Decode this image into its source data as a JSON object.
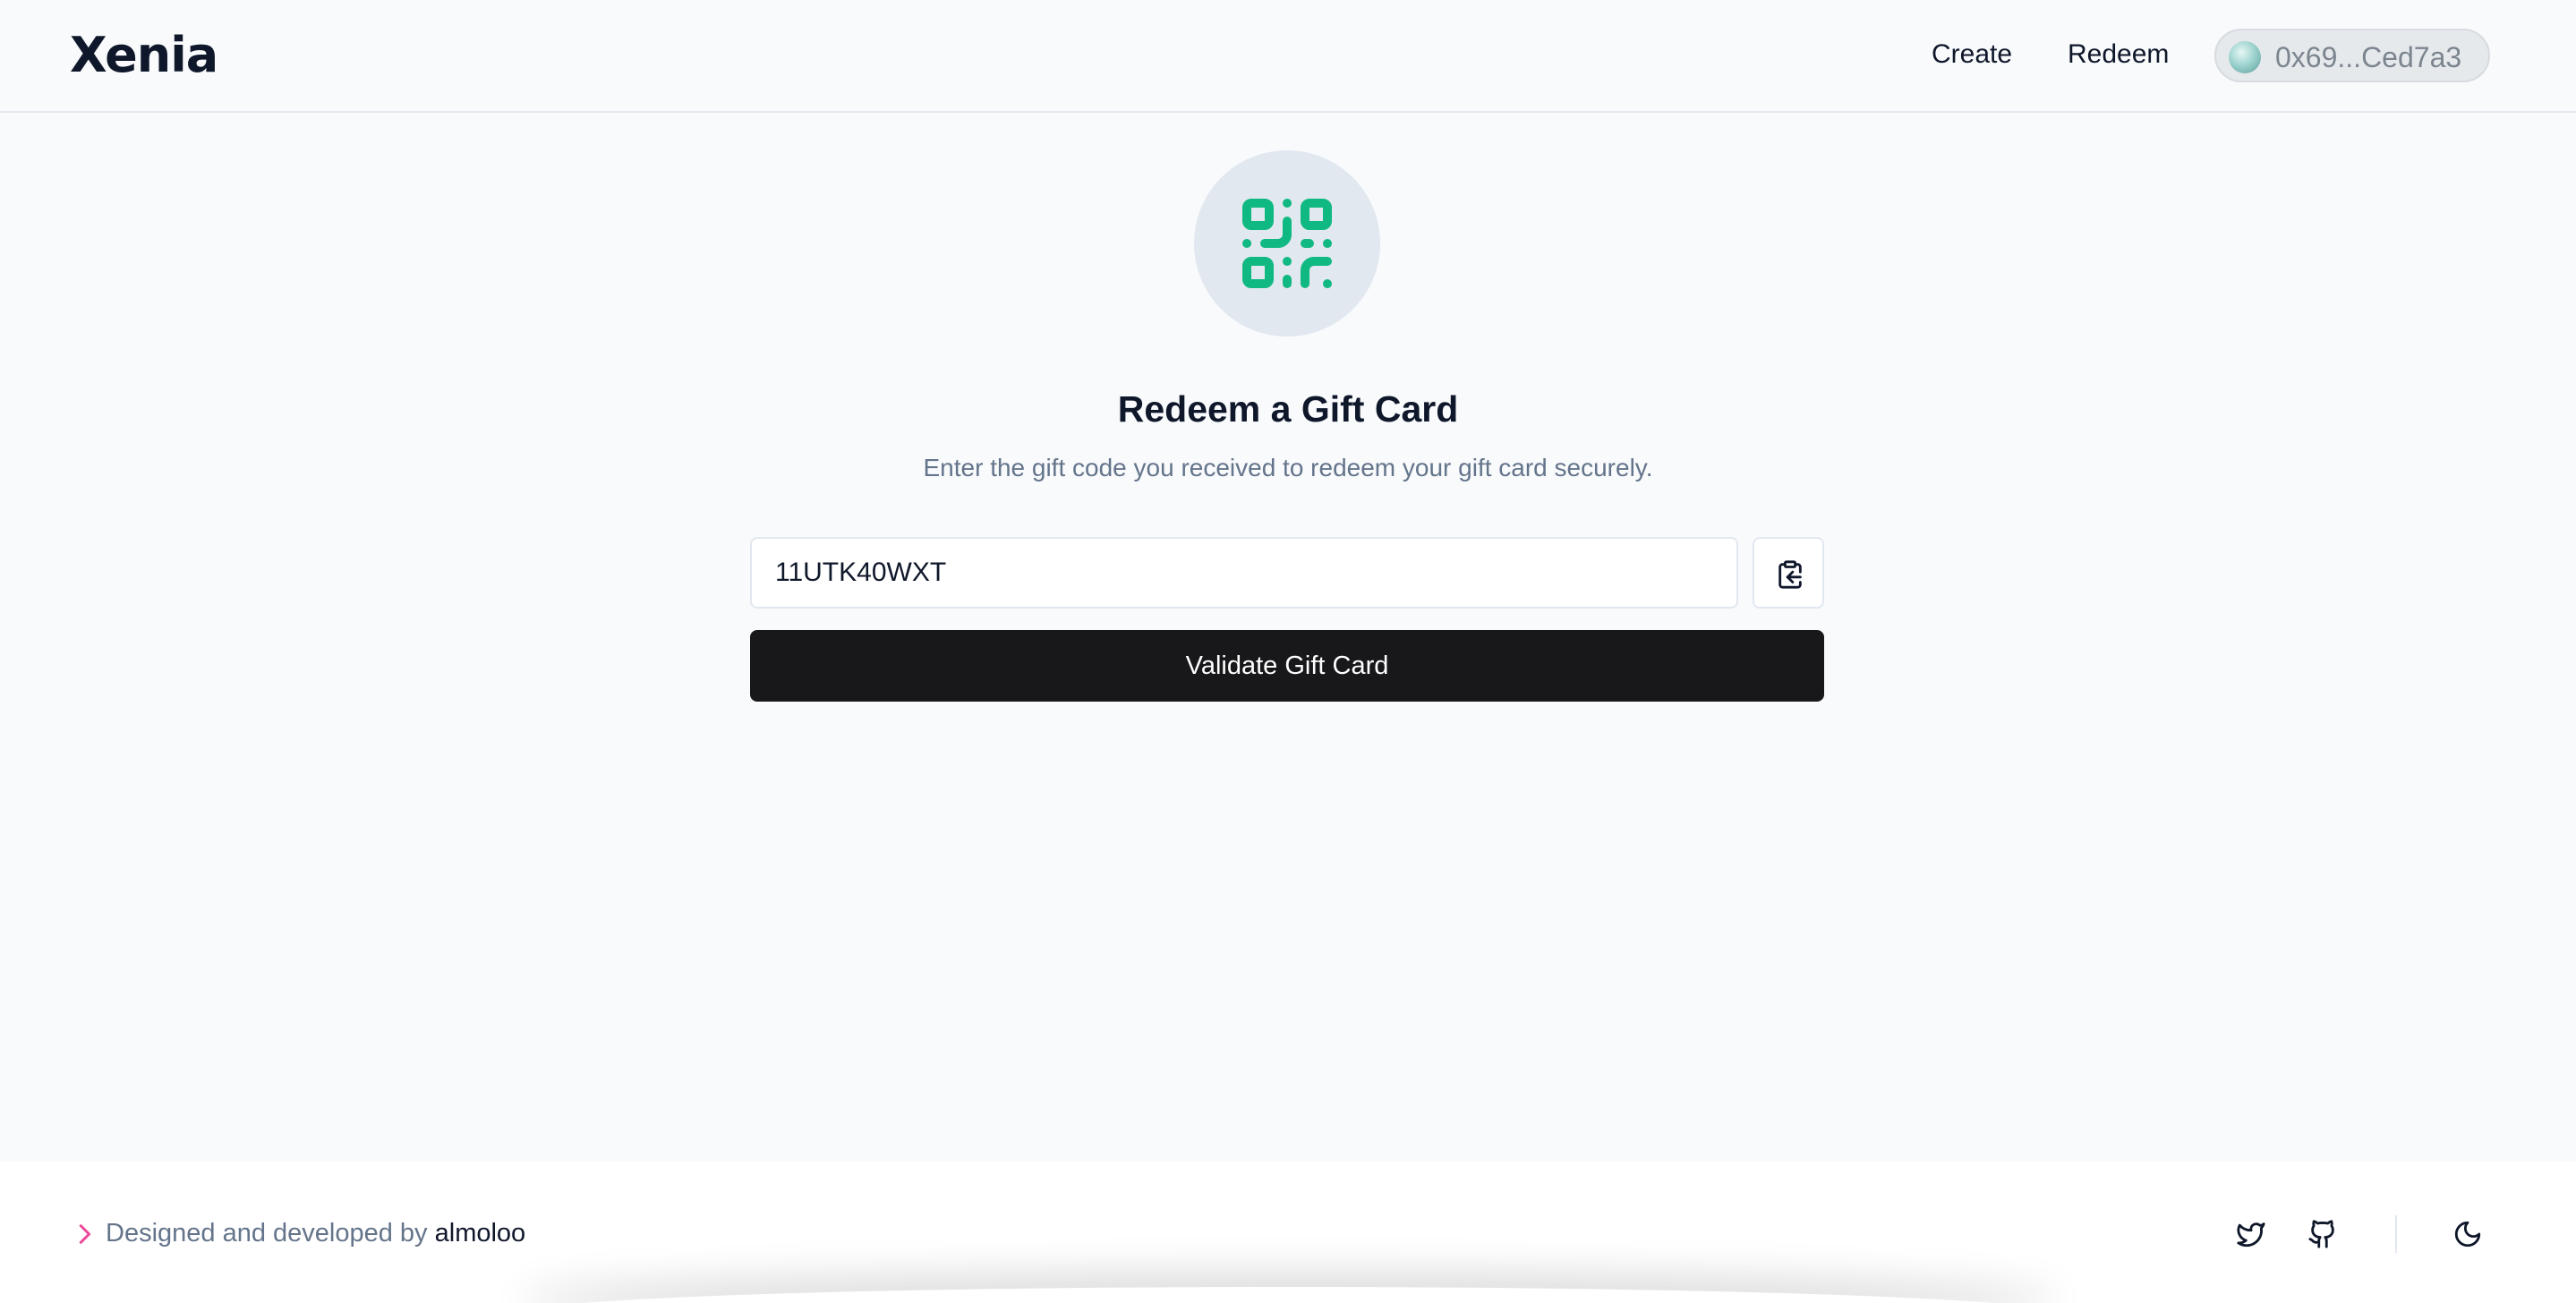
{
  "header": {
    "logo": "Xenia",
    "nav": {
      "create": "Create",
      "redeem": "Redeem"
    },
    "wallet": {
      "address": "0x69...Ced7a3"
    }
  },
  "main": {
    "icon": "qr-code-icon",
    "title": "Redeem a Gift Card",
    "subtitle": "Enter the gift code you received to redeem your gift card securely.",
    "code_input": {
      "value": "11UTK40WXT"
    },
    "paste_icon": "clipboard-paste-icon",
    "validate_label": "Validate Gift Card"
  },
  "footer": {
    "credit_prefix": "Designed and developed by",
    "author": "almoloo",
    "icons": [
      "twitter-icon",
      "github-icon",
      "moon-icon"
    ]
  },
  "colors": {
    "accent": "#10b981",
    "background": "#f8fafc",
    "button": "#18181b",
    "footer_chevron": "#ec4899"
  }
}
